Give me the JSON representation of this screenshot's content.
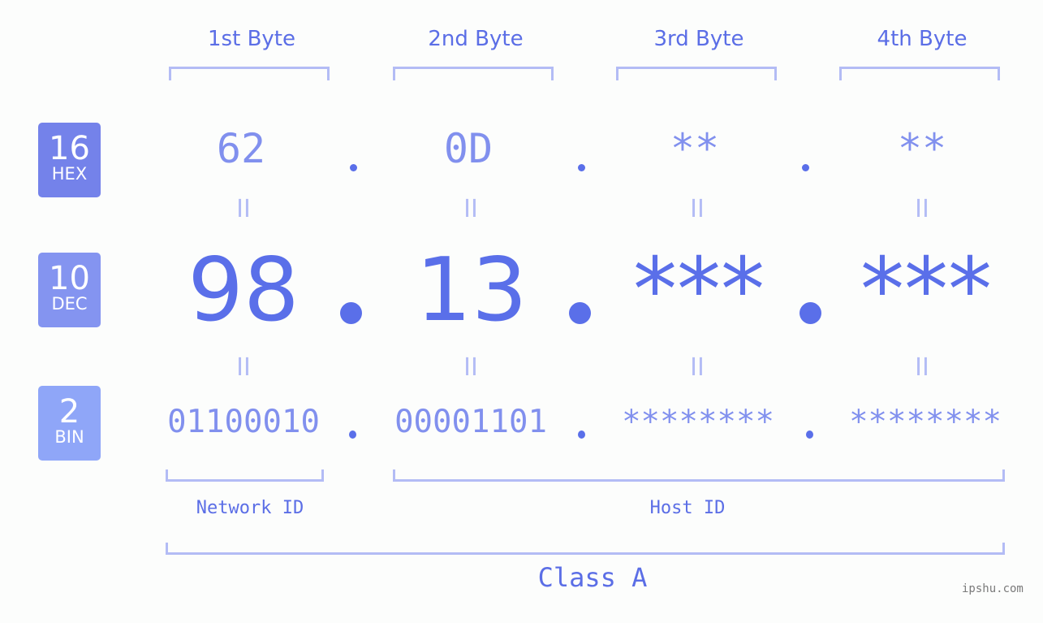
{
  "bytes": {
    "headers": [
      "1st Byte",
      "2nd Byte",
      "3rd Byte",
      "4th Byte"
    ]
  },
  "badges": [
    {
      "base": "16",
      "label": "HEX",
      "color": "#7482ea"
    },
    {
      "base": "10",
      "label": "DEC",
      "color": "#8494f0"
    },
    {
      "base": "2",
      "label": "BIN",
      "color": "#8fa6f8"
    }
  ],
  "hex": [
    "62",
    "0D",
    "**",
    "**"
  ],
  "dec": [
    "98",
    "13",
    "***",
    "***"
  ],
  "bin": [
    "01100010",
    "00001101",
    "********",
    "********"
  ],
  "equals_sign": "II",
  "sections": {
    "network": "Network ID",
    "host": "Host ID",
    "class": "Class A"
  },
  "colors": {
    "primary": "#5a6fe9",
    "secondary": "#8190ee",
    "bracket": "#b3bcf5"
  },
  "watermark": "ipshu.com"
}
